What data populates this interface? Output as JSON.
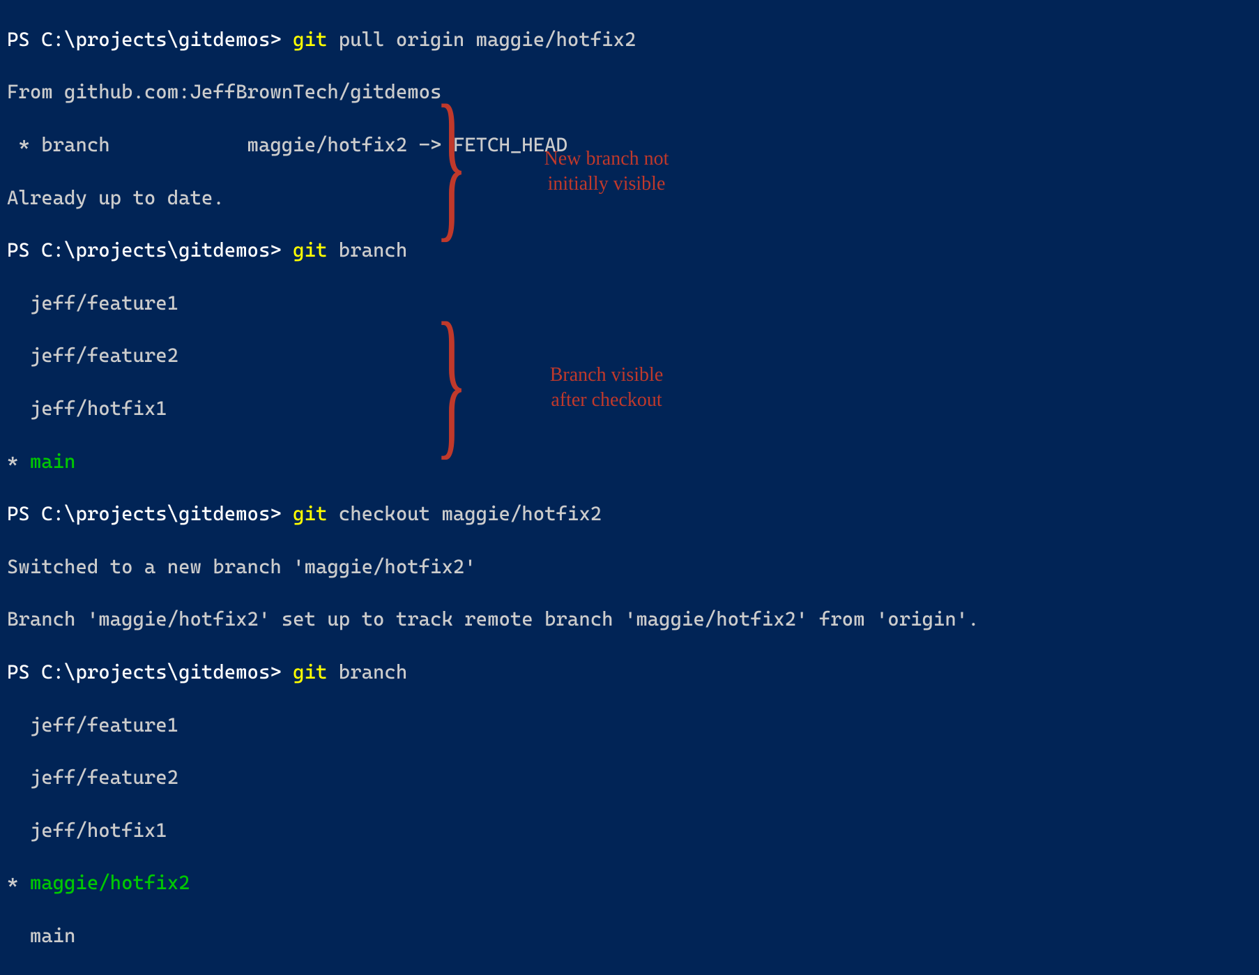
{
  "lines": {
    "l0_pre": "PS C:\\projects\\gitdemos> ",
    "l0_cmd": "git ",
    "l0_args": "pull origin maggie/hotfix2",
    "l1": "From github.com:JeffBrownTech/gitdemos",
    "l2": " * branch            maggie/hotfix2 -> FETCH_HEAD",
    "l3": "Already up to date.",
    "l4_pre": "PS C:\\projects\\gitdemos> ",
    "l4_cmd": "git ",
    "l4_args": "branch",
    "l5": "  jeff/feature1",
    "l6": "  jeff/feature2",
    "l7": "  jeff/hotfix1",
    "l8_star": "* ",
    "l8_name": "main",
    "l9_pre": "PS C:\\projects\\gitdemos> ",
    "l9_cmd": "git ",
    "l9_args": "checkout maggie/hotfix2",
    "l10": "Switched to a new branch 'maggie/hotfix2'",
    "l11": "Branch 'maggie/hotfix2' set up to track remote branch 'maggie/hotfix2' from 'origin'.",
    "l12_pre": "PS C:\\projects\\gitdemos> ",
    "l12_cmd": "git ",
    "l12_args": "branch",
    "l13": "  jeff/feature1",
    "l14": "  jeff/feature2",
    "l15": "  jeff/hotfix1",
    "l16_star": "* ",
    "l16_name": "maggie/hotfix2",
    "l17": "  main"
  },
  "annotations": {
    "a1_line1": "New branch not",
    "a1_line2": "initially visible",
    "a2_line1": "Branch visible",
    "a2_line2": "after checkout"
  }
}
